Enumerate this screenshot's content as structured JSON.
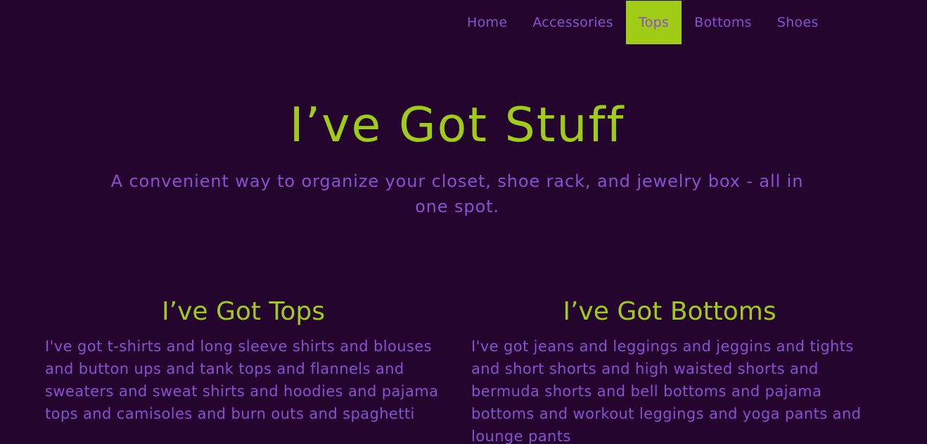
{
  "nav": {
    "items": [
      {
        "label": "Home"
      },
      {
        "label": "Accessories"
      },
      {
        "label": "Tops"
      },
      {
        "label": "Bottoms"
      },
      {
        "label": "Shoes"
      }
    ],
    "active": "Tops"
  },
  "hero": {
    "title": "I’ve Got Stuff",
    "subtitle": "A convenient way to organize your closet, shoe rack, and jewelry box - all in one spot."
  },
  "sections": [
    {
      "title": "I’ve Got Tops",
      "body": "I've got t-shirts and long sleeve shirts and blouses and button ups and tank tops and flannels and sweaters and sweat shirts and hoodies and pajama tops and camisoles and burn outs and spaghetti"
    },
    {
      "title": "I’ve Got Bottoms",
      "body": "I've got jeans and leggings and jeggins and tights and short shorts and high waisted shorts and bermuda shorts and bell bottoms and pajama bottoms and workout leggings and yoga pants and lounge pants"
    }
  ],
  "colors": {
    "background": "#24052e",
    "accent_green": "#a1cc15",
    "accent_purple": "#8b4fd2"
  }
}
